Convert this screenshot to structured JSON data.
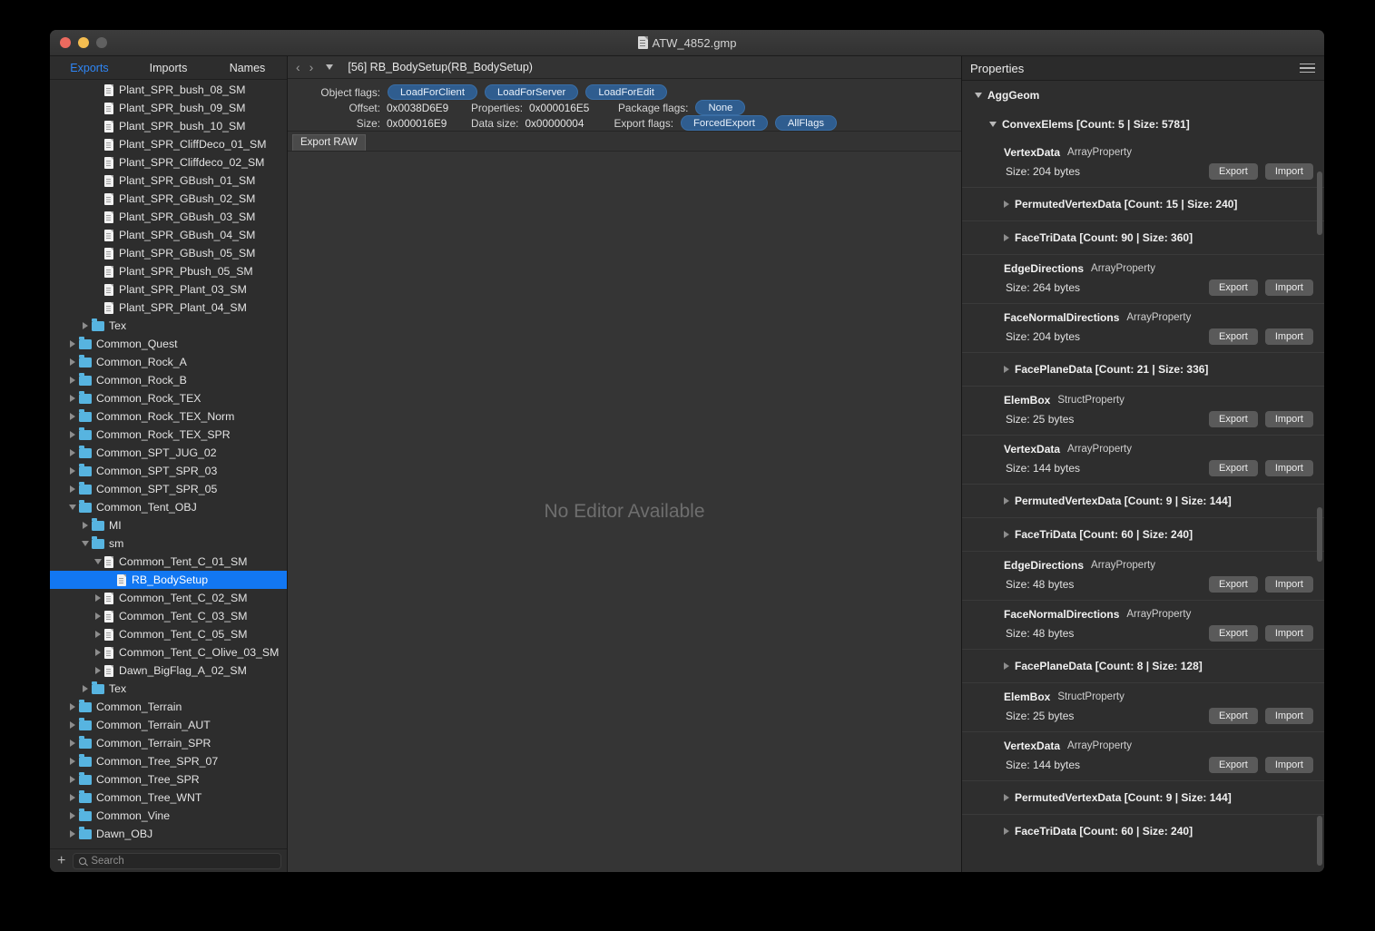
{
  "window": {
    "title": "ATW_4852.gmp",
    "title_icon": "document-icon",
    "controls": [
      "close",
      "minimize",
      "zoom"
    ]
  },
  "sidebar": {
    "tabs": [
      {
        "label": "Exports",
        "active": true
      },
      {
        "label": "Imports",
        "active": false
      },
      {
        "label": "Names",
        "active": false
      }
    ],
    "tree": [
      {
        "label": "Plant_SPR_bush_08_SM",
        "type": "file",
        "depth": 3,
        "twisty": "none"
      },
      {
        "label": "Plant_SPR_bush_09_SM",
        "type": "file",
        "depth": 3,
        "twisty": "none"
      },
      {
        "label": "Plant_SPR_bush_10_SM",
        "type": "file",
        "depth": 3,
        "twisty": "none"
      },
      {
        "label": "Plant_SPR_CliffDeco_01_SM",
        "type": "file",
        "depth": 3,
        "twisty": "none"
      },
      {
        "label": "Plant_SPR_Cliffdeco_02_SM",
        "type": "file",
        "depth": 3,
        "twisty": "none"
      },
      {
        "label": "Plant_SPR_GBush_01_SM",
        "type": "file",
        "depth": 3,
        "twisty": "none"
      },
      {
        "label": "Plant_SPR_GBush_02_SM",
        "type": "file",
        "depth": 3,
        "twisty": "none"
      },
      {
        "label": "Plant_SPR_GBush_03_SM",
        "type": "file",
        "depth": 3,
        "twisty": "none"
      },
      {
        "label": "Plant_SPR_GBush_04_SM",
        "type": "file",
        "depth": 3,
        "twisty": "none"
      },
      {
        "label": "Plant_SPR_GBush_05_SM",
        "type": "file",
        "depth": 3,
        "twisty": "none"
      },
      {
        "label": "Plant_SPR_Pbush_05_SM",
        "type": "file",
        "depth": 3,
        "twisty": "none"
      },
      {
        "label": "Plant_SPR_Plant_03_SM",
        "type": "file",
        "depth": 3,
        "twisty": "none"
      },
      {
        "label": "Plant_SPR_Plant_04_SM",
        "type": "file",
        "depth": 3,
        "twisty": "none"
      },
      {
        "label": "Tex",
        "type": "folder",
        "depth": 2,
        "twisty": "right"
      },
      {
        "label": "Common_Quest",
        "type": "folder",
        "depth": 1,
        "twisty": "right"
      },
      {
        "label": "Common_Rock_A",
        "type": "folder",
        "depth": 1,
        "twisty": "right"
      },
      {
        "label": "Common_Rock_B",
        "type": "folder",
        "depth": 1,
        "twisty": "right"
      },
      {
        "label": "Common_Rock_TEX",
        "type": "folder",
        "depth": 1,
        "twisty": "right"
      },
      {
        "label": "Common_Rock_TEX_Norm",
        "type": "folder",
        "depth": 1,
        "twisty": "right"
      },
      {
        "label": "Common_Rock_TEX_SPR",
        "type": "folder",
        "depth": 1,
        "twisty": "right"
      },
      {
        "label": "Common_SPT_JUG_02",
        "type": "folder",
        "depth": 1,
        "twisty": "right"
      },
      {
        "label": "Common_SPT_SPR_03",
        "type": "folder",
        "depth": 1,
        "twisty": "right"
      },
      {
        "label": "Common_SPT_SPR_05",
        "type": "folder",
        "depth": 1,
        "twisty": "right"
      },
      {
        "label": "Common_Tent_OBJ",
        "type": "folder",
        "depth": 1,
        "twisty": "down"
      },
      {
        "label": "MI",
        "type": "folder",
        "depth": 2,
        "twisty": "right"
      },
      {
        "label": "sm",
        "type": "folder",
        "depth": 2,
        "twisty": "down"
      },
      {
        "label": "Common_Tent_C_01_SM",
        "type": "file",
        "depth": 3,
        "twisty": "down"
      },
      {
        "label": "RB_BodySetup",
        "type": "file",
        "depth": 4,
        "twisty": "none",
        "selected": true
      },
      {
        "label": "Common_Tent_C_02_SM",
        "type": "file",
        "depth": 3,
        "twisty": "right"
      },
      {
        "label": "Common_Tent_C_03_SM",
        "type": "file",
        "depth": 3,
        "twisty": "right"
      },
      {
        "label": "Common_Tent_C_05_SM",
        "type": "file",
        "depth": 3,
        "twisty": "right"
      },
      {
        "label": "Common_Tent_C_Olive_03_SM",
        "type": "file",
        "depth": 3,
        "twisty": "right"
      },
      {
        "label": "Dawn_BigFlag_A_02_SM",
        "type": "file",
        "depth": 3,
        "twisty": "right"
      },
      {
        "label": "Tex",
        "type": "folder",
        "depth": 2,
        "twisty": "right"
      },
      {
        "label": "Common_Terrain",
        "type": "folder",
        "depth": 1,
        "twisty": "right"
      },
      {
        "label": "Common_Terrain_AUT",
        "type": "folder",
        "depth": 1,
        "twisty": "right"
      },
      {
        "label": "Common_Terrain_SPR",
        "type": "folder",
        "depth": 1,
        "twisty": "right"
      },
      {
        "label": "Common_Tree_SPR_07",
        "type": "folder",
        "depth": 1,
        "twisty": "right"
      },
      {
        "label": "Common_Tree_SPR",
        "type": "folder",
        "depth": 1,
        "twisty": "right"
      },
      {
        "label": "Common_Tree_WNT",
        "type": "folder",
        "depth": 1,
        "twisty": "right"
      },
      {
        "label": "Common_Vine",
        "type": "folder",
        "depth": 1,
        "twisty": "right"
      },
      {
        "label": "Dawn_OBJ",
        "type": "folder",
        "depth": 1,
        "twisty": "right"
      }
    ],
    "add_button": "+",
    "search": {
      "placeholder": "Search",
      "value": ""
    }
  },
  "center": {
    "nav_back": "‹",
    "nav_forward": "›",
    "breadcrumb": "[56] RB_BodySetup(RB_BodySetup)",
    "info": {
      "object_flags_label": "Object flags:",
      "object_flags": [
        "LoadForClient",
        "LoadForServer",
        "LoadForEdit"
      ],
      "offset_label": "Offset:",
      "offset_value": "0x0038D6E9",
      "properties_label": "Properties:",
      "properties_value": "0x000016E5",
      "package_flags_label": "Package flags:",
      "package_flags": [
        "None"
      ],
      "size_label": "Size:",
      "size_value": "0x000016E9",
      "data_size_label": "Data size:",
      "data_size_value": "0x00000004",
      "export_flags_label": "Export flags:",
      "export_flags": [
        "ForcedExport",
        "AllFlags"
      ]
    },
    "raw_tab": "Export RAW",
    "placeholder": "No Editor Available"
  },
  "properties": {
    "title": "Properties",
    "menu_icon": "hamburger-icon",
    "export_label": "Export",
    "import_label": "Import",
    "nodes": [
      {
        "kind": "node",
        "label": "AggGeom",
        "twisty": "down",
        "indent": 0
      },
      {
        "kind": "node",
        "label": "ConvexElems [Count: 5 | Size: 5781]",
        "twisty": "down",
        "indent": 1
      },
      {
        "kind": "prop",
        "name": "VertexData",
        "type": "ArrayProperty",
        "size": "Size: 204 bytes",
        "indent": 2
      },
      {
        "kind": "node",
        "label": "PermutedVertexData [Count: 15 | Size: 240]",
        "twisty": "right",
        "indent": 2,
        "divider": true
      },
      {
        "kind": "node",
        "label": "FaceTriData [Count: 90 | Size: 360]",
        "twisty": "right",
        "indent": 2,
        "divider": true
      },
      {
        "kind": "prop",
        "name": "EdgeDirections",
        "type": "ArrayProperty",
        "size": "Size: 264 bytes",
        "indent": 2,
        "divider": true
      },
      {
        "kind": "prop",
        "name": "FaceNormalDirections",
        "type": "ArrayProperty",
        "size": "Size: 204 bytes",
        "indent": 2,
        "divider": true
      },
      {
        "kind": "node",
        "label": "FacePlaneData [Count: 21 | Size: 336]",
        "twisty": "right",
        "indent": 2,
        "divider": true
      },
      {
        "kind": "prop",
        "name": "ElemBox",
        "type": "StructProperty",
        "size": "Size: 25 bytes",
        "indent": 2,
        "divider": true
      },
      {
        "kind": "prop",
        "name": "VertexData",
        "type": "ArrayProperty",
        "size": "Size: 144 bytes",
        "indent": 2,
        "divider": true
      },
      {
        "kind": "node",
        "label": "PermutedVertexData [Count: 9 | Size: 144]",
        "twisty": "right",
        "indent": 2,
        "divider": true
      },
      {
        "kind": "node",
        "label": "FaceTriData [Count: 60 | Size: 240]",
        "twisty": "right",
        "indent": 2,
        "divider": true
      },
      {
        "kind": "prop",
        "name": "EdgeDirections",
        "type": "ArrayProperty",
        "size": "Size: 48 bytes",
        "indent": 2,
        "divider": true
      },
      {
        "kind": "prop",
        "name": "FaceNormalDirections",
        "type": "ArrayProperty",
        "size": "Size: 48 bytes",
        "indent": 2,
        "divider": true
      },
      {
        "kind": "node",
        "label": "FacePlaneData [Count: 8 | Size: 128]",
        "twisty": "right",
        "indent": 2,
        "divider": true
      },
      {
        "kind": "prop",
        "name": "ElemBox",
        "type": "StructProperty",
        "size": "Size: 25 bytes",
        "indent": 2,
        "divider": true
      },
      {
        "kind": "prop",
        "name": "VertexData",
        "type": "ArrayProperty",
        "size": "Size: 144 bytes",
        "indent": 2,
        "divider": true
      },
      {
        "kind": "node",
        "label": "PermutedVertexData [Count: 9 | Size: 144]",
        "twisty": "right",
        "indent": 2,
        "divider": true
      },
      {
        "kind": "node",
        "label": "FaceTriData [Count: 60 | Size: 240]",
        "twisty": "right",
        "indent": 2,
        "divider": true
      }
    ]
  },
  "colors": {
    "accent_blue": "#2f86f5",
    "selection_blue": "#1277f2",
    "pill_blue": "#2f5d8f",
    "folder_blue": "#57b4e0",
    "window_bg": "#2b2b2b",
    "canvas_bg": "#353535"
  }
}
